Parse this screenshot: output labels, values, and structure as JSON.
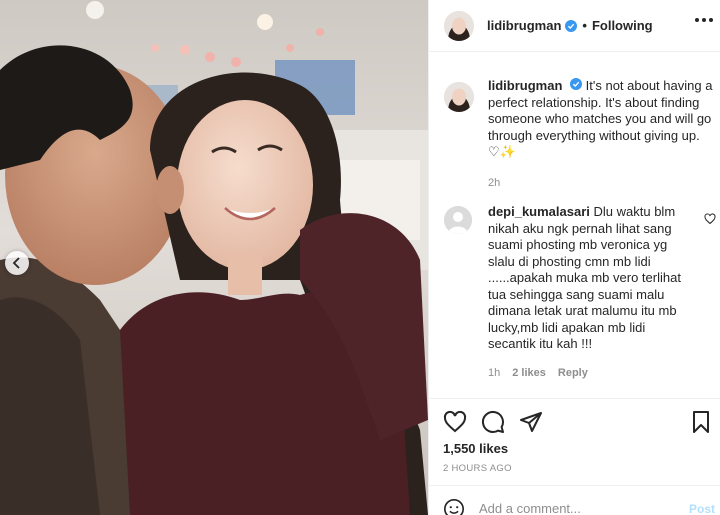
{
  "post": {
    "photo_alt": "",
    "nav": {
      "prev_icon": "chevron-left-icon"
    }
  },
  "header": {
    "username": "lidibrugman",
    "separator": "•",
    "follow_label": "Following",
    "more_icon": "more-horizontal-icon"
  },
  "caption": {
    "username": "lidibrugman",
    "text": "It's not about having a perfect relationship. It's about finding someone who matches you and will go through everything without giving up. ♡✨",
    "time": "2h"
  },
  "comment": {
    "username": "depi_kumalasari",
    "text": "Dlu waktu blm nikah aku ngk pernah lihat sang suami phosting mb veronica yg slalu di phosting cmn mb lidi ......apakah muka mb vero terlihat tua sehingga sang suami malu dimana letak urat malumu itu mb lucky,mb lidi apakan mb lidi secantik itu kah !!!",
    "time": "1h",
    "likes": "2 likes",
    "reply": "Reply"
  },
  "actions": {
    "likes_count": "1,550 likes",
    "posted_ago": "2 HOURS AGO"
  },
  "add_comment": {
    "placeholder": "Add a comment...",
    "post_label": "Post"
  },
  "colors": {
    "verified": "#3897f0",
    "link_disabled": "#b2dffc",
    "muted": "#8e8e8e",
    "text": "#262626"
  }
}
